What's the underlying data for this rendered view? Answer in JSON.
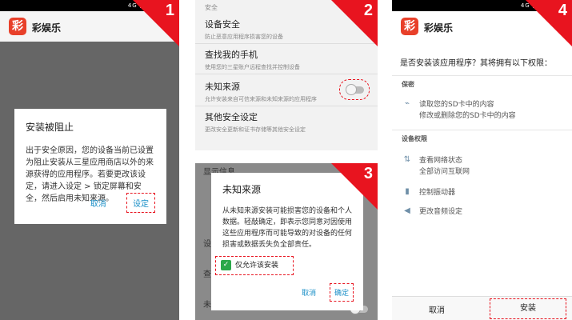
{
  "status": {
    "icons": "4G ▲ 7"
  },
  "app": {
    "name": "彩娱乐",
    "logo_char": "彩"
  },
  "steps": [
    "1",
    "2",
    "3",
    "4"
  ],
  "panel1": {
    "dialog_title": "安装被阻止",
    "dialog_body": "出于安全原因，您的设备当前已设置为阻止安装从三星应用商店以外的来源获得的应用程序。若要更改该设定，请进入设定 > 锁定屏幕和安全，然后启用未知来源。",
    "cancel": "取消",
    "settings": "设定"
  },
  "panel2": {
    "section": "安全",
    "items": [
      {
        "title": "设备安全",
        "desc": "防止恶意应用程序损害您的设备"
      },
      {
        "title": "查找我的手机",
        "desc": "使用您的三星账户远程查找并控制设备"
      },
      {
        "title": "未知来源",
        "desc": "允许安装来自可信来源和未知来源的应用程序"
      },
      {
        "title": "其他安全设定",
        "desc": "更改安全更新和证书存储等其他安全设定"
      }
    ],
    "unknown_sources_on": false
  },
  "panel3": {
    "bg_fragments": [
      "显示信息",
      "设",
      "查",
      "未"
    ],
    "dialog_title": "未知来源",
    "dialog_body": "从未知来源安装可能损害您的设备和个人数据。轻敲确定，即表示您同意对因使用这些应用程序而可能导致的对设备的任何损害或数据丢失负全部责任。",
    "checkbox_label": "仅允许该安装",
    "checkbox_checked": true,
    "cancel": "取消",
    "ok": "确定"
  },
  "panel4": {
    "question": "是否安装该应用程序？其将拥有以下权限：",
    "privacy_header": "保密",
    "privacy_items": [
      "读取您的SD卡中的内容",
      "修改或删除您的SD卡中的内容"
    ],
    "device_header": "设备权限",
    "device_items": [
      {
        "icon": "arrows-icon",
        "lines": [
          "查看网络状态",
          "全部访问互联网"
        ]
      },
      {
        "icon": "battery-icon",
        "lines": [
          "控制振动器"
        ]
      },
      {
        "icon": "volume-icon",
        "lines": [
          "更改音频设定"
        ]
      }
    ],
    "cancel": "取消",
    "install": "安装"
  }
}
